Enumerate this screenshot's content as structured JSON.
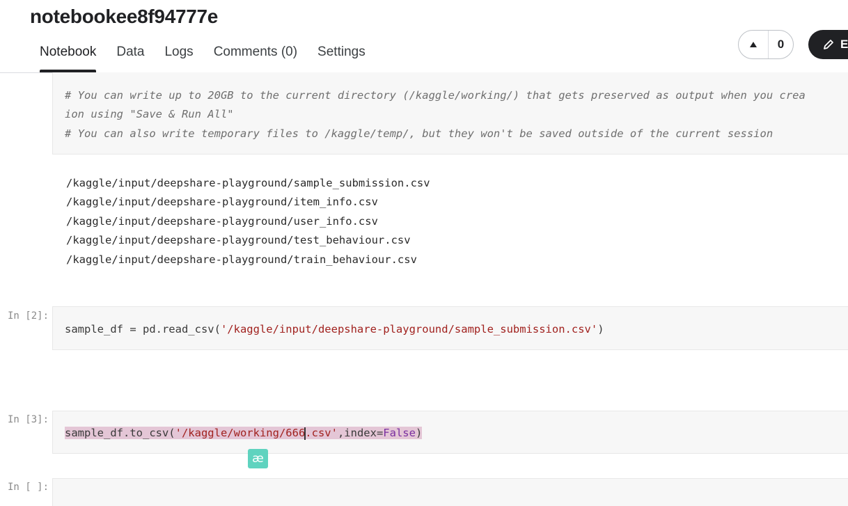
{
  "notebook": {
    "title": "notebookee8f94777e",
    "tabs": [
      "Notebook",
      "Data",
      "Logs",
      "Comments (0)",
      "Settings"
    ],
    "vote_count": "0",
    "edit_label": "E"
  },
  "cells": {
    "cell1": {
      "lines": [
        "# You can write up to 20GB to the current directory (/kaggle/working/) that gets preserved as output when you crea",
        "ion using \"Save & Run All\"",
        "# You can also write temporary files to /kaggle/temp/, but they won't be saved outside of the current session"
      ],
      "output": [
        "/kaggle/input/deepshare-playground/sample_submission.csv",
        "/kaggle/input/deepshare-playground/item_info.csv",
        "/kaggle/input/deepshare-playground/user_info.csv",
        "/kaggle/input/deepshare-playground/test_behaviour.csv",
        "/kaggle/input/deepshare-playground/train_behaviour.csv"
      ]
    },
    "cell2": {
      "prompt": "In [2]:",
      "code_prefix": "sample_df = pd.read_csv(",
      "code_string": "'/kaggle/input/deepshare-playground/sample_submission.csv'",
      "code_suffix": ")"
    },
    "cell3": {
      "prompt": "In [3]:",
      "code_prefix": "sample_df.to_csv(",
      "code_string_a": "'/kaggle/working/666",
      "code_string_b": ".csv'",
      "code_mid": ",index=",
      "code_kw": "False",
      "code_suffix": ")"
    },
    "cell4": {
      "prompt": "In [ ]:"
    }
  },
  "overlay": {
    "badge_text": "æ"
  }
}
